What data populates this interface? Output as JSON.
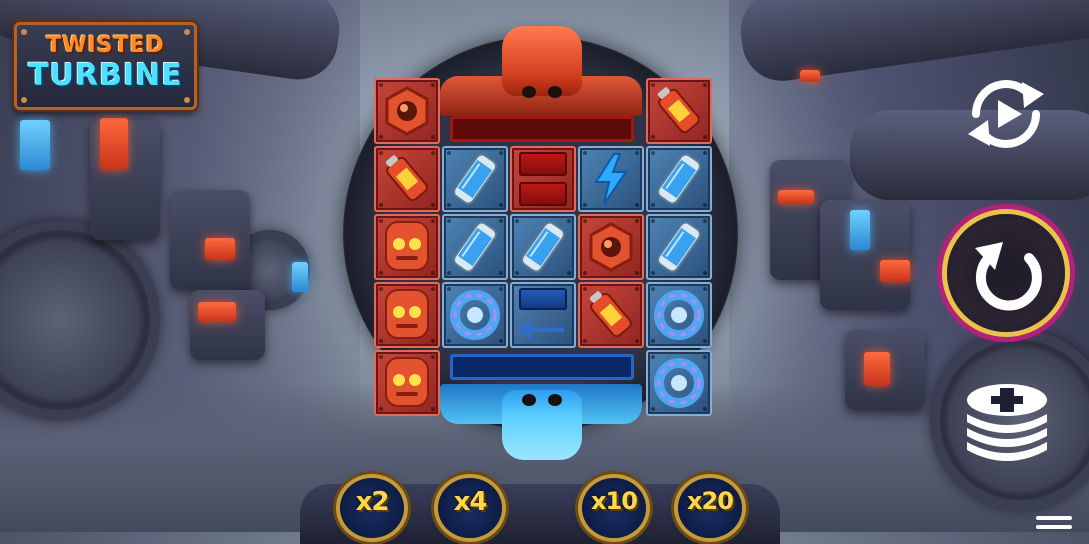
{
  "game": {
    "logo": {
      "line1": "TWISTED",
      "line2": "TURBINE"
    }
  },
  "reels": {
    "grid": [
      [
        "hex-nut-red",
        null,
        null,
        null,
        "battery-red"
      ],
      [
        "battery-red",
        "canister-blue",
        "slot-red",
        "lightning-blue",
        "canister-blue"
      ],
      [
        "robot-red",
        "canister-blue",
        "canister-blue",
        "hex-nut-red",
        "canister-blue"
      ],
      [
        "robot-red",
        "gear-blue",
        "arrow-left-blue",
        "battery-red",
        "gear-blue"
      ],
      [
        "robot-red",
        null,
        null,
        null,
        "gear-blue"
      ]
    ]
  },
  "multipliers": [
    {
      "label": "x2",
      "active": false
    },
    {
      "label": "x4",
      "active": false
    },
    {
      "label": "x10",
      "active": false
    },
    {
      "label": "x20",
      "active": false
    }
  ],
  "controls": {
    "autoplay": "autoplay-icon",
    "spin": "spin-icon",
    "bet": "coin-stack-plus-icon",
    "menu": "hamburger-menu-icon"
  },
  "colors": {
    "red_robot": "#d43e1e",
    "blue_robot": "#5fd0ff",
    "multiplier_text": "#ffd84a",
    "spin_ring": "#b3227a"
  }
}
